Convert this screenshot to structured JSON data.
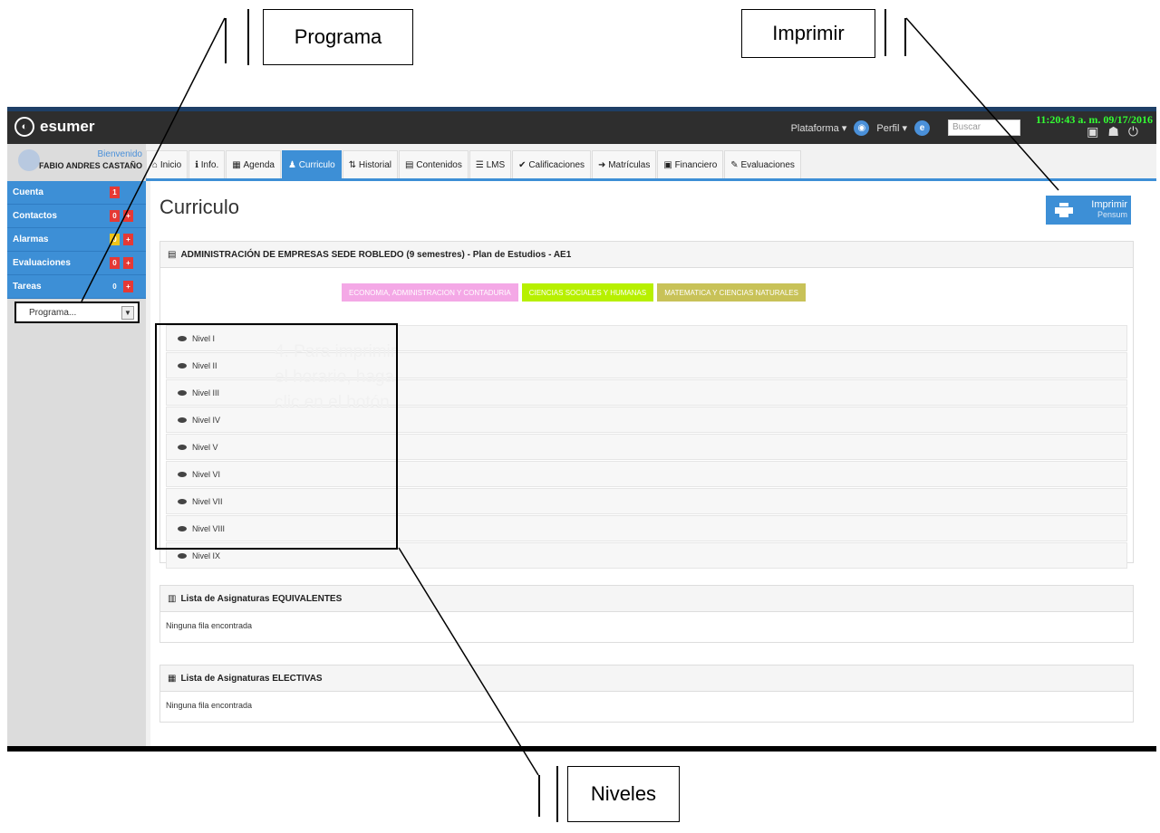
{
  "app": {
    "name": "esumer",
    "clock": "11:20:43 a. m. 09/17/2016"
  },
  "topnav": {
    "platform": "Plataforma ▾",
    "profile": "Perfil ▾",
    "search_placeholder": "Buscar"
  },
  "user": {
    "welcome": "Bienvenido",
    "name": "FABIO ANDRES CASTAÑO"
  },
  "sidebar": {
    "items": [
      {
        "label": "Cuenta",
        "badges": [
          "1"
        ]
      },
      {
        "label": "Contactos",
        "badges": [
          "0",
          "+"
        ]
      },
      {
        "label": "Alarmas",
        "badges": [
          "0",
          "+"
        ]
      },
      {
        "label": "Evaluaciones",
        "badges": [
          "0",
          "+"
        ]
      },
      {
        "label": "Tareas",
        "badges": [
          "0",
          "+"
        ]
      }
    ],
    "program_select": "Programa..."
  },
  "tabs": [
    "Inicio",
    "Info.",
    "Agenda",
    "Curriculo",
    "Historial",
    "Contenidos",
    "LMS",
    "Calificaciones",
    "Matrículas",
    "Financiero",
    "Evaluaciones"
  ],
  "page": {
    "title": "Curriculo",
    "print_label": "Imprimir",
    "print_sub": "Pensum"
  },
  "plan": {
    "heading": "ADMINISTRACIÓN DE EMPRESAS SEDE ROBLEDO (9 semestres) - Plan de Estudios - AE1",
    "categories": [
      {
        "label": "ECONOMIA, ADMINISTRACION Y CONTADURIA",
        "color": "#f4a8e6"
      },
      {
        "label": "CIENCIAS SOCIALES Y HUMANAS",
        "color": "#b7f000"
      },
      {
        "label": "MATEMATICA Y CIENCIAS NATURALES",
        "color": "#c8c258"
      }
    ],
    "levels": [
      "Nivel I",
      "Nivel II",
      "Nivel III",
      "Nivel IV",
      "Nivel V",
      "Nivel VI",
      "Nivel VII",
      "Nivel VIII",
      "Nivel IX"
    ],
    "ghost_text": "4. Para imprimir el horario, haga clic en el botón"
  },
  "equivalentes": {
    "heading": "Lista de Asignaturas EQUIVALENTES",
    "empty": "Ninguna fila encontrada"
  },
  "electivas": {
    "heading": "Lista de Asignaturas ELECTIVAS",
    "empty": "Ninguna fila encontrada"
  },
  "annotations": {
    "programa": "Programa",
    "imprimir": "Imprimir",
    "niveles": "Niveles"
  },
  "colors": {
    "accent": "#3d8fd6",
    "topbar": "#2e2e2e",
    "clock": "#33ff33"
  }
}
